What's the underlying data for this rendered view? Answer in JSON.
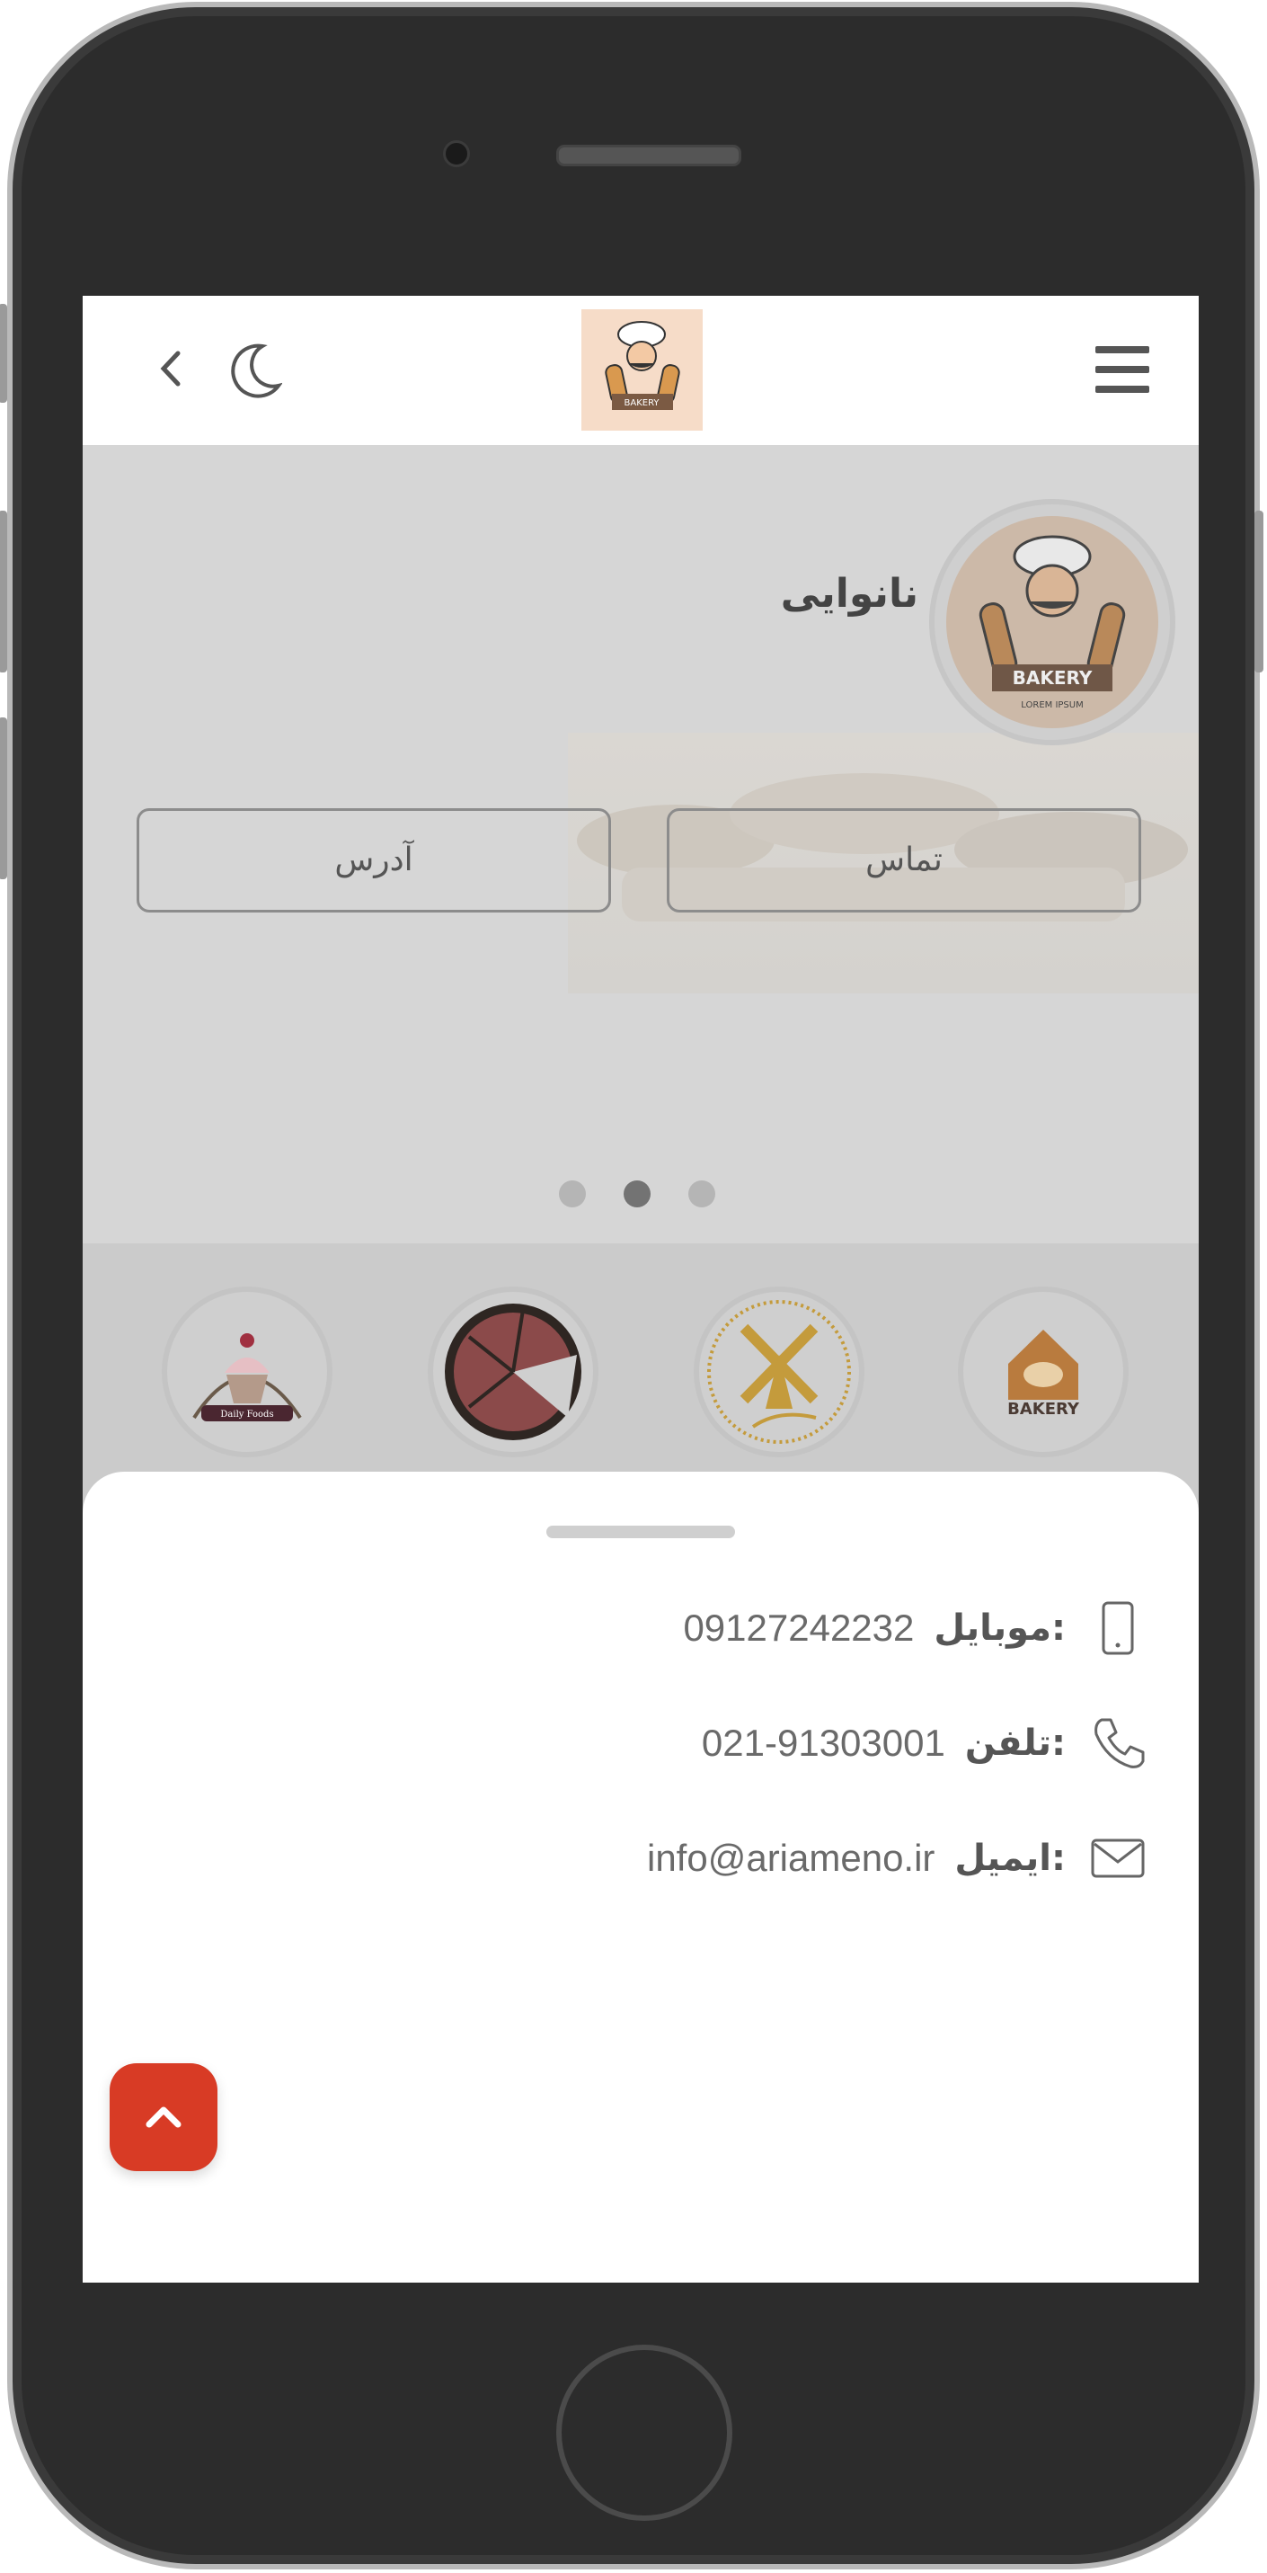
{
  "header": {
    "menu_icon": "hamburger-icon",
    "logo_icon": "bakery-logo",
    "logo_text": "BAKERY",
    "theme_icon": "moon-icon",
    "back_icon": "chevron-left-icon"
  },
  "hero": {
    "shop_name": "نانوایی",
    "profile_logo_text": "BAKERY",
    "profile_logo_subtext": "LOREM IPSUM",
    "contact_button": "تماس",
    "address_button": "آدرس",
    "slides_total": 3,
    "active_slide": 2
  },
  "categories": {
    "items": [
      {
        "icon": "bakery-house-logo",
        "text": "BAKERY"
      },
      {
        "icon": "windmill-logo",
        "text": ""
      },
      {
        "icon": "pie-logo",
        "text": ""
      },
      {
        "icon": "cupcake-logo",
        "text": "Daily Foods"
      }
    ]
  },
  "contact_sheet": {
    "rows": [
      {
        "icon": "mobile-icon",
        "label": "موبایل:",
        "value": "09127242232"
      },
      {
        "icon": "phone-icon",
        "label": "تلفن:",
        "value": "021-91303001"
      },
      {
        "icon": "mail-icon",
        "label": "ایمیل:",
        "value": "info@ariameno.ir"
      }
    ],
    "scroll_top_icon": "chevron-up-icon"
  },
  "colors": {
    "accent": "#d83b25",
    "overlay": "#d6d6d6",
    "text_dark": "#444444"
  }
}
